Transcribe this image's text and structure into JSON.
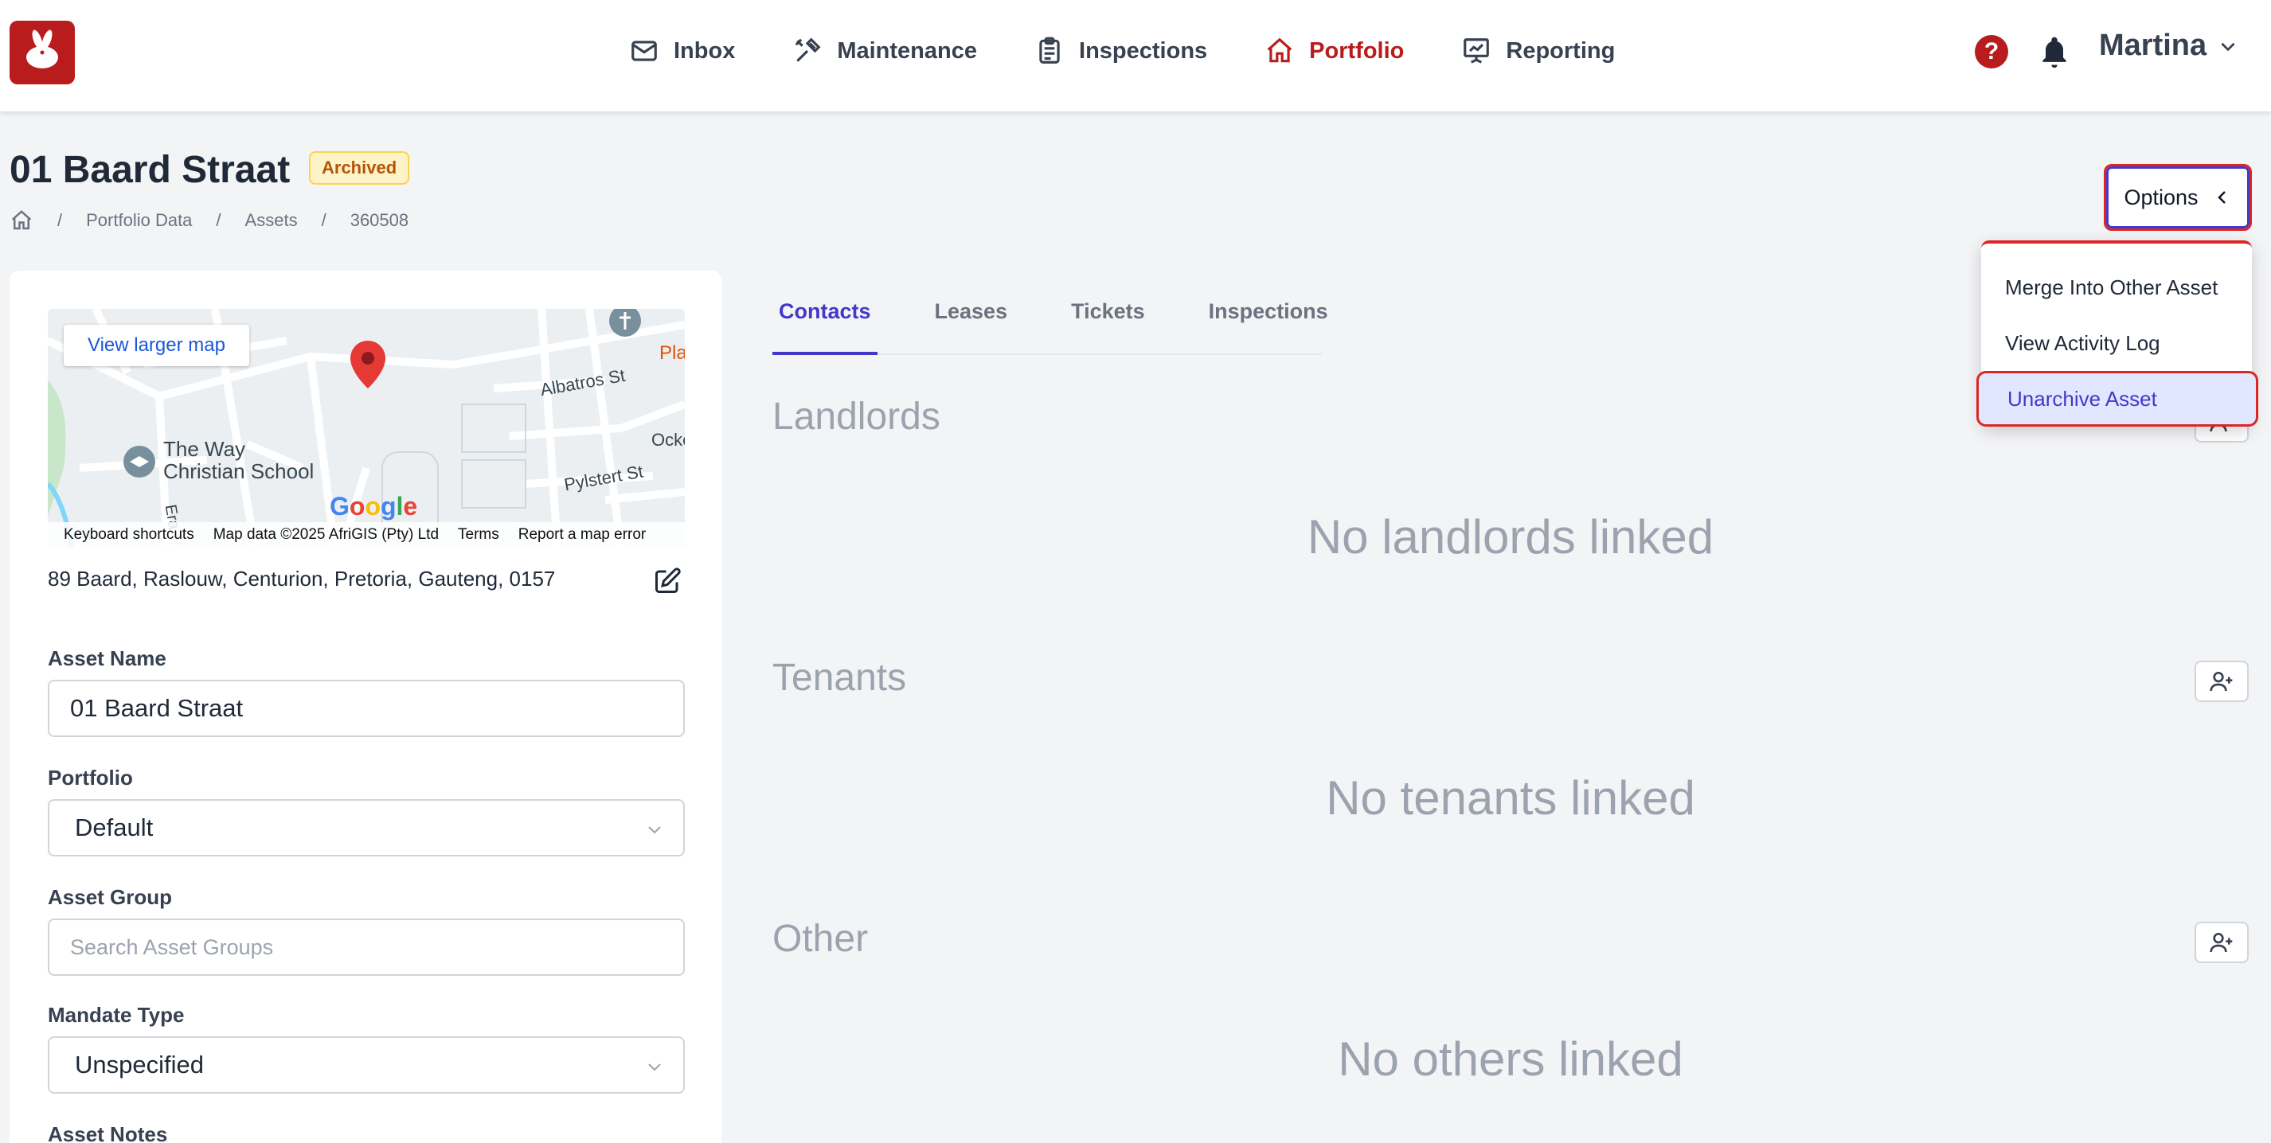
{
  "nav": {
    "items": [
      {
        "label": "Inbox",
        "icon": "envelope-icon"
      },
      {
        "label": "Maintenance",
        "icon": "tools-icon"
      },
      {
        "label": "Inspections",
        "icon": "clipboard-icon"
      },
      {
        "label": "Portfolio",
        "icon": "home-icon",
        "active": true
      },
      {
        "label": "Reporting",
        "icon": "presentation-chart-icon"
      }
    ],
    "user_name": "Martina"
  },
  "header": {
    "title": "01 Baard Straat",
    "status_badge": "Archived",
    "breadcrumb": [
      "Portfolio Data",
      "Assets",
      "360508"
    ],
    "options_label": "Options"
  },
  "options_menu": {
    "items": [
      "Merge Into Other Asset",
      "View Activity Log",
      "Unarchive Asset"
    ]
  },
  "map": {
    "view_larger": "View larger map",
    "labels": {
      "school": "The Way\nChristian School",
      "street1": "Albatros St",
      "street2": "Pylstert St",
      "street3": "Ocke",
      "street4": "Era",
      "place": "Pla"
    },
    "google": "Google",
    "footer": [
      "Keyboard shortcuts",
      "Map data ©2025 AfriGIS (Pty) Ltd",
      "Terms",
      "Report a map error"
    ]
  },
  "asset": {
    "address": "89 Baard, Raslouw, Centurion, Pretoria, Gauteng, 0157",
    "name_label": "Asset Name",
    "name_value": "01 Baard Straat",
    "portfolio_label": "Portfolio",
    "portfolio_value": "Default",
    "group_label": "Asset Group",
    "group_placeholder": "Search Asset Groups",
    "mandate_label": "Mandate Type",
    "mandate_value": "Unspecified",
    "notes_label": "Asset Notes"
  },
  "tabs": [
    "Contacts",
    "Leases",
    "Tickets",
    "Inspections"
  ],
  "contacts": {
    "landlords_title": "Landlords",
    "landlords_empty": "No landlords linked",
    "tenants_title": "Tenants",
    "tenants_empty": "No tenants linked",
    "other_title": "Other",
    "other_empty": "No others linked"
  },
  "colors": {
    "brand": "#b91c1c",
    "accent": "#4338ca",
    "badge_bg": "#fef3c7",
    "badge_text": "#b45309"
  }
}
